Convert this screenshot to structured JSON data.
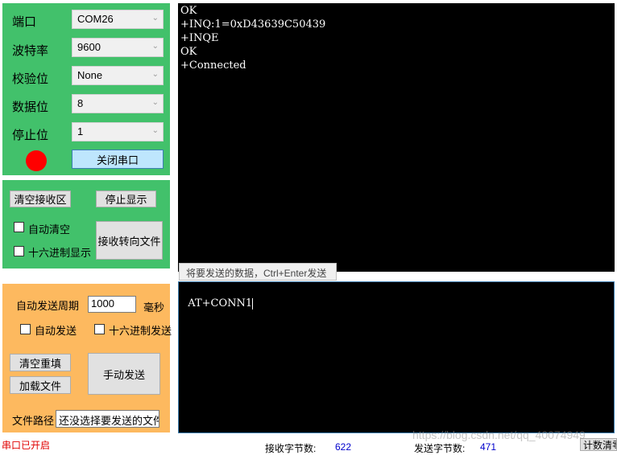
{
  "serial": {
    "port_label": "端口",
    "port_value": "COM26",
    "baud_label": "波特率",
    "baud_value": "9600",
    "parity_label": "校验位",
    "parity_value": "None",
    "databits_label": "数据位",
    "databits_value": "8",
    "stopbits_label": "停止位",
    "stopbits_value": "1",
    "indicator_color": "#ff0000",
    "close_button": "关闭串口"
  },
  "receive": {
    "clear_button": "清空接收区",
    "stop_display_button": "停止显示",
    "auto_clear_label": "自动清空",
    "hex_display_label": "十六进制显示",
    "to_file_button": "接收转向文件"
  },
  "send": {
    "period_label": "自动发送周期",
    "period_value": "1000",
    "period_unit": "毫秒",
    "auto_send_label": "自动发送",
    "hex_send_label": "十六进制发送",
    "clear_refill_button": "清空重填",
    "load_file_button": "加载文件",
    "manual_send_button": "手动发送",
    "file_path_label": "文件路径",
    "file_path_value": "还没选择要发送的文件"
  },
  "terminal": {
    "lines": [
      "OK",
      "+INQ:1=0xD43639C50439",
      "+INQE",
      "OK",
      "+Connected"
    ]
  },
  "send_area": {
    "tooltip": "将要发送的数据，Ctrl+Enter发送",
    "text": "AT+CONN1"
  },
  "status": {
    "port_status": "串口已开启",
    "port_status_color": "#e00000",
    "rx_label": "接收字节数:",
    "rx_value": "622",
    "tx_label": "发送字节数:",
    "tx_value": "471",
    "reset_button": "计数清零",
    "watermark": "https://blog.csdn.net/qq_40074949"
  }
}
